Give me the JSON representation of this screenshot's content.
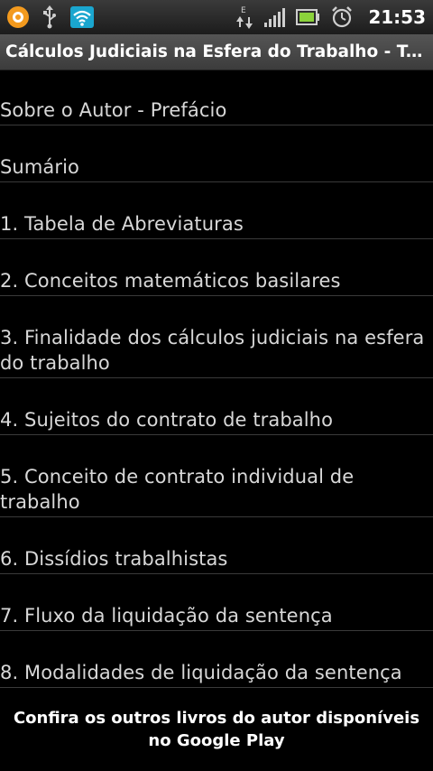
{
  "status_bar": {
    "time": "21:53",
    "icons": [
      "app-notification-icon",
      "usb-icon",
      "wifi-icon",
      "data-transfer-icon",
      "signal-icon",
      "battery-icon",
      "alarm-clock-icon"
    ],
    "network_type": "E"
  },
  "title_bar": {
    "title": "Cálculos Judiciais na Esfera do Trabalho - Teoria e Prática"
  },
  "list": {
    "items": [
      "Sobre o Autor - Prefácio",
      "Sumário",
      "1. Tabela de Abreviaturas",
      "2. Conceitos matemáticos basilares",
      "3. Finalidade dos cálculos judiciais na esfera do trabalho",
      "4. Sujeitos do contrato de trabalho",
      "5. Conceito de contrato individual de trabalho",
      "6. Dissídios trabalhistas",
      "7. Fluxo da liquidação da sentença",
      "8. Modalidades de liquidação da sentença"
    ]
  },
  "banner": {
    "text": "Confira os outros livros do autor disponíveis no Google Play"
  },
  "colors": {
    "status_bar_bg": "#2a2a2a",
    "title_bar_bg": "#474747",
    "list_bg": "#000000",
    "list_text": "#d8d8d8",
    "divider": "#3a3a3a",
    "wifi_accent": "#2ec4e6",
    "battery_green": "#8bd23b"
  }
}
